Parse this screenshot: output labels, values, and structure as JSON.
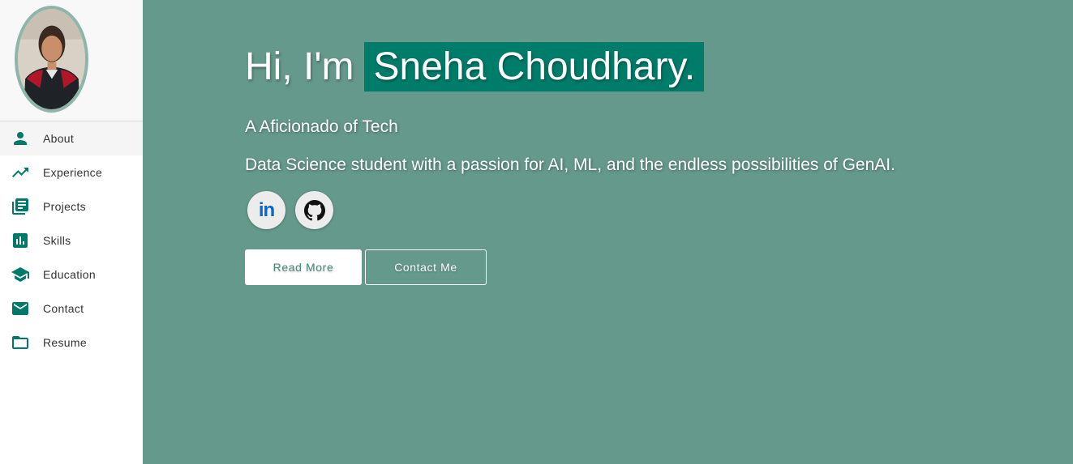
{
  "sidebar": {
    "items": [
      {
        "label": "About",
        "icon": "person-icon",
        "active": true
      },
      {
        "label": "Experience",
        "icon": "trending-up-icon"
      },
      {
        "label": "Projects",
        "icon": "library-books-icon"
      },
      {
        "label": "Skills",
        "icon": "bar-chart-icon"
      },
      {
        "label": "Education",
        "icon": "graduation-cap-icon"
      },
      {
        "label": "Contact",
        "icon": "mail-icon"
      },
      {
        "label": "Resume",
        "icon": "folder-icon"
      }
    ]
  },
  "hero": {
    "greeting": "Hi, I'm",
    "name": "Sneha Choudhary.",
    "subtitle": "A Aficionado of Tech",
    "tagline": "Data Science student with a passion for AI, ML, and the endless possibilities of GenAI.",
    "social": [
      {
        "label": "in",
        "icon": "linkedin-icon"
      },
      {
        "icon": "github-icon"
      }
    ],
    "read_more_label": "Read More",
    "contact_label": "Contact Me"
  },
  "colors": {
    "background": "#65998b",
    "accent": "#007c6a",
    "icon": "#00796b"
  }
}
